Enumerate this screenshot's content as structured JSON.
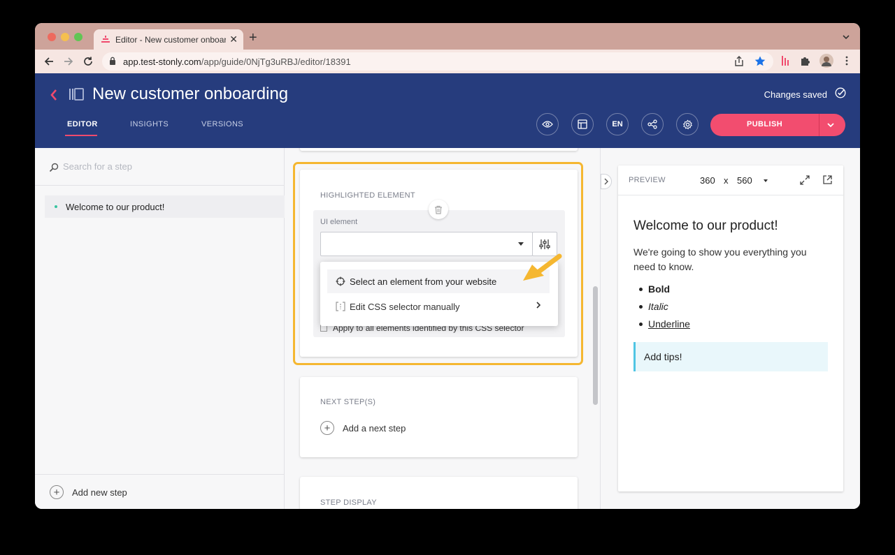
{
  "browser": {
    "tab_title": "Editor - New customer onboarding",
    "tab_close": "✕",
    "new_tab": "+",
    "url_host": "app.test-stonly.com",
    "url_path": "/app/guide/0NjTg3uRBJ/editor/18391",
    "colors": {
      "traffic_red": "#ed6a5e",
      "traffic_yellow": "#f5bf4f",
      "traffic_green": "#61c554"
    }
  },
  "header": {
    "title": "New customer onboarding",
    "status": "Changes saved",
    "tabs": [
      {
        "label": "EDITOR",
        "active": true
      },
      {
        "label": "INSIGHTS",
        "active": false
      },
      {
        "label": "VERSIONS",
        "active": false
      }
    ],
    "language": "EN",
    "publish_label": "PUBLISH",
    "colors": {
      "header_bg": "#263c7d",
      "accent": "#f24d6f"
    }
  },
  "sidebar": {
    "search_placeholder": "Search for a step",
    "steps": [
      {
        "label": "Welcome to our product!"
      }
    ],
    "add_step_label": "Add new step"
  },
  "editor": {
    "highlight_card": {
      "title": "HIGHLIGHTED ELEMENT",
      "ui_element_label": "UI element",
      "select_value": "",
      "apply_all_label": "Apply to all elements identified by this CSS selector",
      "outline_color": "#f5b731"
    },
    "dropdown": {
      "items": [
        {
          "label": "Select an element from your website",
          "icon": "crosshair-icon"
        },
        {
          "label": "Edit CSS selector manually",
          "icon": "css-bracket-icon"
        }
      ]
    },
    "next_card": {
      "title": "NEXT STEP(S)",
      "add_label": "Add a next step"
    },
    "display_card": {
      "title": "STEP DISPLAY"
    }
  },
  "preview": {
    "label": "PREVIEW",
    "width": "360",
    "times": "x",
    "height": "560",
    "title": "Welcome to our product!",
    "body": "We're going to show you everything you need to know.",
    "list": [
      "Bold",
      "Italic",
      "Underline"
    ],
    "tip": "Add tips!"
  }
}
